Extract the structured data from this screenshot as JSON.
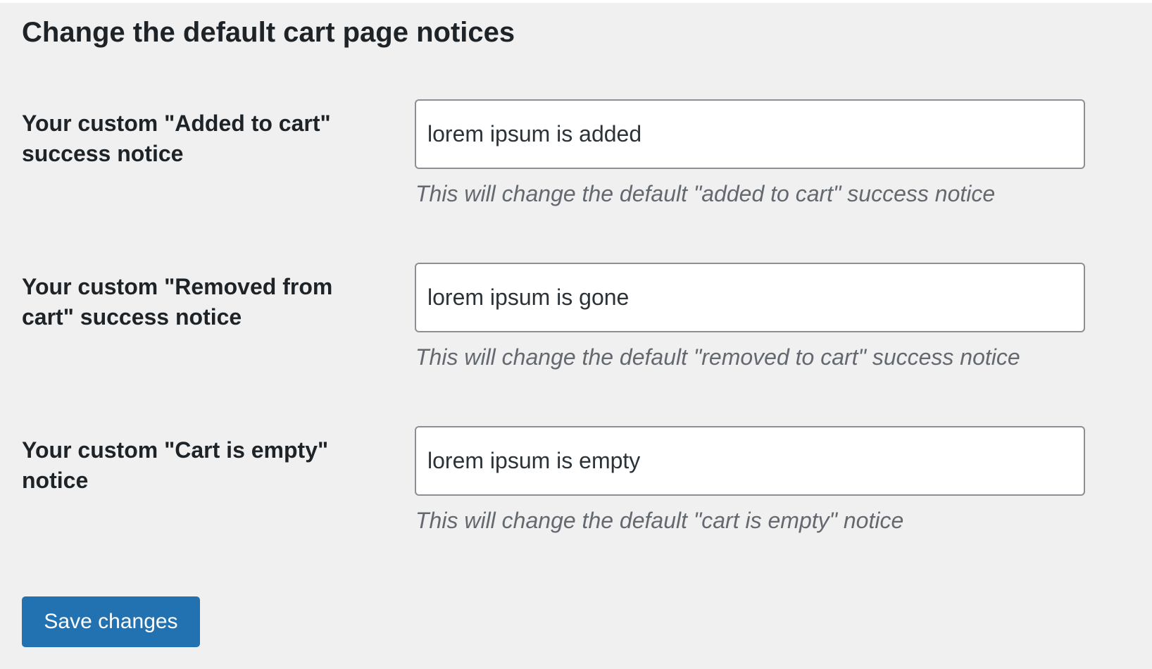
{
  "page": {
    "title": "Change the default cart page notices"
  },
  "fields": [
    {
      "label": "Your custom \"Added to cart\" success notice",
      "value": "lorem ipsum is added",
      "description": "This will change the default \"added to cart\" success notice"
    },
    {
      "label": "Your custom \"Removed from cart\" success notice",
      "value": "lorem ipsum is gone",
      "description": "This will change the default \"removed to cart\" success notice"
    },
    {
      "label": "Your custom \"Cart is empty\" notice",
      "value": "lorem ipsum is empty",
      "description": "This will change the default \"cart is empty\" notice"
    }
  ],
  "actions": {
    "save_label": "Save changes"
  },
  "colors": {
    "background": "#f0f0f1",
    "primary_button": "#2271b1",
    "input_border": "#8c8f94",
    "description_text": "#646970"
  }
}
